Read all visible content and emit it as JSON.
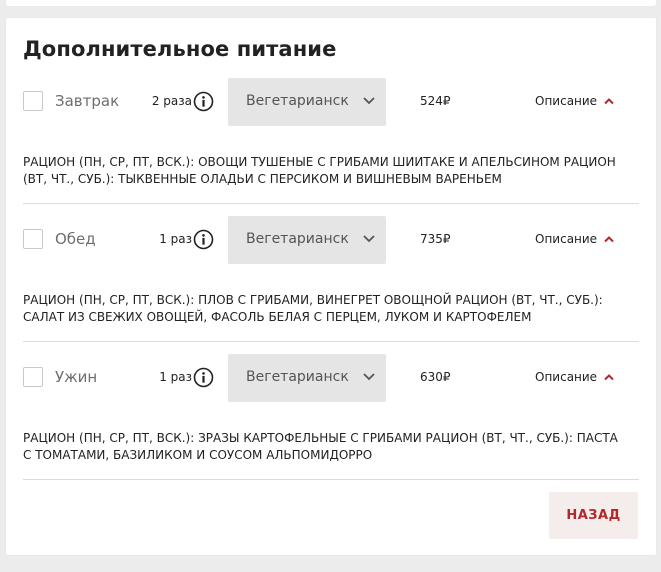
{
  "title": "Дополнительное питание",
  "meals": [
    {
      "name": "Завтрак",
      "times": "2 раза",
      "diet": "Вегетарианск",
      "price": "524₽",
      "desc_label": "Описание",
      "description": "РАЦИОН (ПН, СР, ПТ, ВСК.): ОВОЩИ ТУШЕНЫЕ С ГРИБАМИ ШИИТАКЕ И АПЕЛЬСИНОМ РАЦИОН (ВТ, ЧТ., СУБ.): ТЫКВЕННЫЕ ОЛАДЬИ С ПЕРСИКОМ И ВИШНЕВЫМ ВАРЕНЬЕМ",
      "checked": false
    },
    {
      "name": "Обед",
      "times": "1 раз",
      "diet": "Вегетарианск",
      "price": "735₽",
      "desc_label": "Описание",
      "description": "РАЦИОН (ПН, СР, ПТ, ВСК.): ПЛОВ С ГРИБАМИ, ВИНЕГРЕТ ОВОЩНОЙ РАЦИОН (ВТ, ЧТ., СУБ.): САЛАТ ИЗ СВЕЖИХ ОВОЩЕЙ, ФАСОЛЬ БЕЛАЯ С ПЕРЦЕМ, ЛУКОМ И КАРТОФЕЛЕМ",
      "checked": false
    },
    {
      "name": "Ужин",
      "times": "1 раз",
      "diet": "Вегетарианск",
      "price": "630₽",
      "desc_label": "Описание",
      "description": "РАЦИОН (ПН, СР, ПТ, ВСК.): ЗРАЗЫ КАРТОФЕЛЬНЫЕ С ГРИБАМИ РАЦИОН (ВТ, ЧТ., СУБ.): ПАСТА С ТОМАТАМИ, БАЗИЛИКОМ И СОУСОМ АЛЬПОМИДОРРО",
      "checked": false
    }
  ],
  "back_label": "НАЗАД",
  "colors": {
    "accent": "#b3282b",
    "back_bg": "#f5ecec",
    "dropdown_bg": "#e5e5e5"
  },
  "icons": {
    "info": "info-icon",
    "dropdown": "chevron-down-icon",
    "toggle": "chevron-up-icon"
  }
}
